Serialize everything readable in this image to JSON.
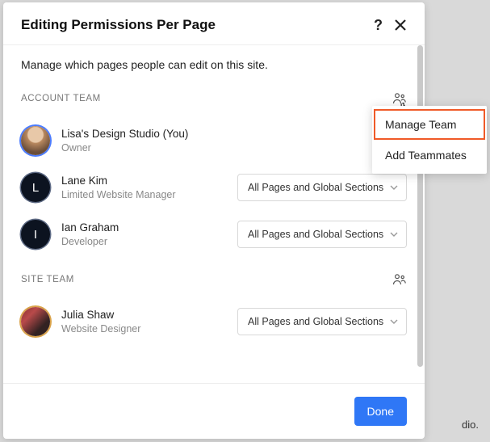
{
  "modal": {
    "title": "Editing Permissions Per Page",
    "intro": "Manage which pages people can edit on this site.",
    "done": "Done"
  },
  "sections": {
    "account": {
      "label": "ACCOUNT TEAM"
    },
    "site": {
      "label": "SITE TEAM"
    }
  },
  "members": {
    "acc0": {
      "name": "Lisa's Design Studio (You)",
      "role": "Owner"
    },
    "acc1": {
      "name": "Lane Kim",
      "role": "Limited Website Manager",
      "initial": "L",
      "perm": "All Pages and Global Sections"
    },
    "acc2": {
      "name": "Ian Graham",
      "role": "Developer",
      "initial": "I",
      "perm": "All Pages and Global Sections"
    },
    "site0": {
      "name": "Julia Shaw",
      "role": "Website Designer",
      "perm": "All Pages and Global Sections"
    }
  },
  "popup": {
    "manage": "Manage Team",
    "add": "Add Teammates"
  },
  "background": {
    "snippet": "dio."
  }
}
